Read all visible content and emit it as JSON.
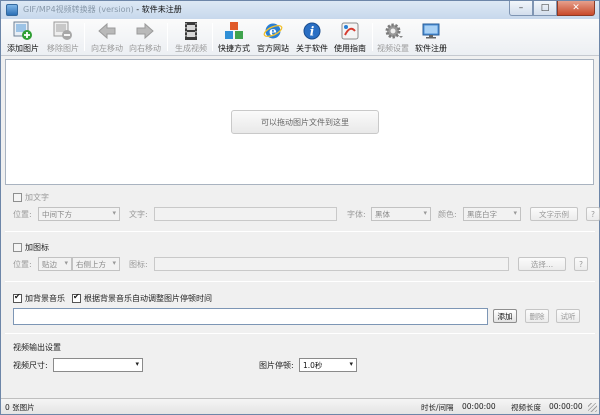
{
  "window": {
    "title_prefix": "GIF/MP4视频转换器 (version)",
    "title_suffix": " - 软件未注册",
    "minimize": "–",
    "maximize": "□",
    "close": "✕"
  },
  "toolbar": {
    "items": [
      {
        "label": "添加图片",
        "icon": "add-image-icon",
        "enabled": true
      },
      {
        "label": "移除图片",
        "icon": "remove-image-icon",
        "enabled": false
      },
      {
        "label": "向左移动",
        "icon": "arrow-left-icon",
        "enabled": false
      },
      {
        "label": "向右移动",
        "icon": "arrow-right-icon",
        "enabled": false
      },
      {
        "label": "生成视频",
        "icon": "film-icon",
        "enabled": false
      },
      {
        "label": "快捷方式",
        "icon": "cubes-icon",
        "enabled": true
      },
      {
        "label": "官方网站",
        "icon": "ie-icon",
        "enabled": true
      },
      {
        "label": "关于软件",
        "icon": "info-icon",
        "enabled": true
      },
      {
        "label": "使用指南",
        "icon": "guide-icon",
        "enabled": true
      },
      {
        "label": "视频设置",
        "icon": "gear-icon",
        "enabled": false
      },
      {
        "label": "软件注册",
        "icon": "monitor-icon",
        "enabled": true
      }
    ]
  },
  "drop_area": {
    "hint": "可以拖动图片文件到这里"
  },
  "text_section": {
    "checkbox_label": "加文字",
    "checked": false,
    "position_label": "位置:",
    "position_value": "中间下方",
    "text_label": "文字:",
    "font_label": "字体:",
    "font_value": "黑体",
    "color_label": "颜色:",
    "color_value": "黑底白字",
    "sample_button": "文字示例",
    "help_button": "?"
  },
  "icon_section": {
    "checkbox_label": "加图标",
    "checked": false,
    "position_label": "位置:",
    "position_value_1": "贴边",
    "position_value_2": "右侧上方",
    "icon_label": "图标:",
    "select_button": "选择...",
    "help_button": "?"
  },
  "music_section": {
    "checkbox_label": "加背景音乐",
    "checked": true,
    "auto_label": "根据背景音乐自动调整图片停顿时间",
    "auto_checked": true,
    "add_button": "添加",
    "delete_button": "删除",
    "listen_button": "试听"
  },
  "output_section": {
    "heading": "视频输出设置",
    "size_label": "视频尺寸:",
    "size_value": "",
    "pause_label": "图片停顿:",
    "pause_value": "1.0秒"
  },
  "status": {
    "count": "0 张图片",
    "duration_label": "时长/间隔",
    "duration_value": "00:00:00",
    "video_label": "视频长度",
    "video_value": "00:00:00"
  },
  "colors": {
    "title_gradient": "#c7d8ec",
    "close_button": "#c94a2b",
    "window_bg": "#f0f0f0"
  }
}
